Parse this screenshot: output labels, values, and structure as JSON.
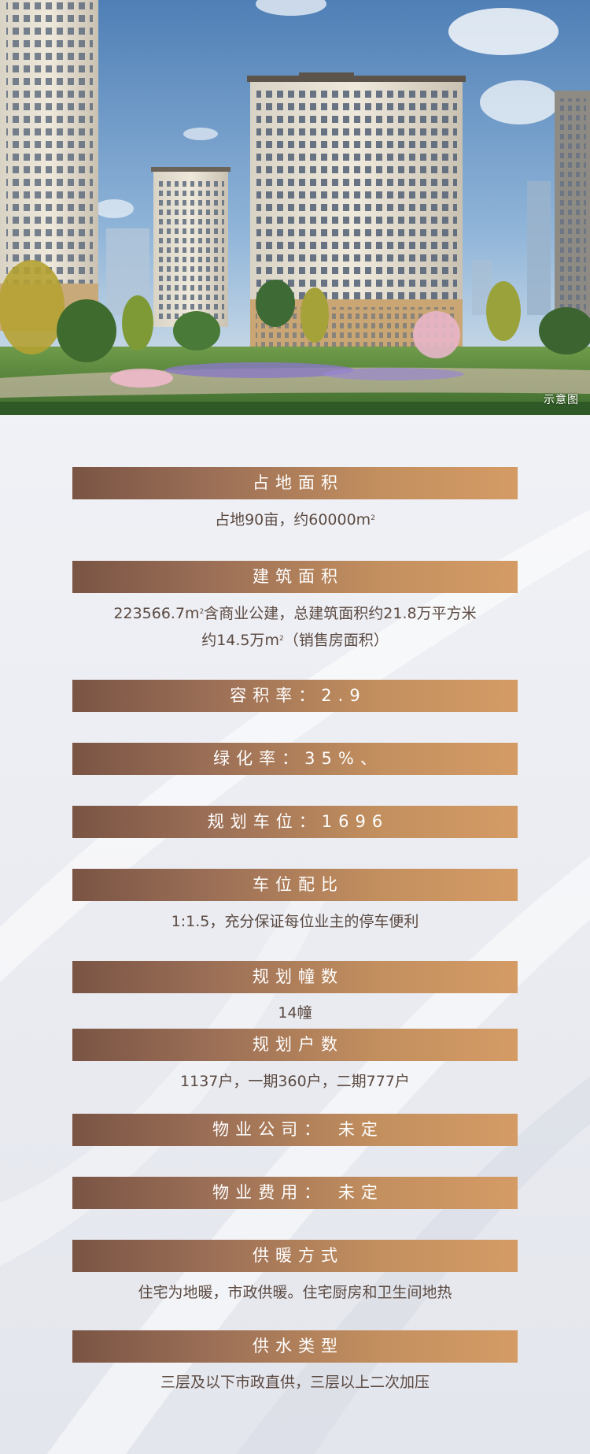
{
  "hero": {
    "caption": "示意图"
  },
  "sections": [
    {
      "title": "占地面积",
      "lines": [
        {
          "text": "占地90亩，约60000m",
          "sup": "2",
          "after": ""
        }
      ]
    },
    {
      "title": "建筑面积",
      "lines": [
        {
          "text": "223566.7m",
          "sup": "2",
          "after": "含商业公建，总建筑面积约21.8万平方米"
        },
        {
          "text": "约14.5万m",
          "sup": "2",
          "after": "（销售房面积）"
        }
      ]
    },
    {
      "title": "容积率：2.9",
      "lines": []
    },
    {
      "title": "绿化率：35%、",
      "lines": []
    },
    {
      "title": "规划车位：1696",
      "lines": []
    },
    {
      "title": "车位配比",
      "lines": [
        {
          "text": "1:1.5，充分保证每位业主的停车便利"
        }
      ]
    },
    {
      "title": "规划幢数",
      "lines": [
        {
          "text": "14幢"
        }
      ]
    },
    {
      "title": "规划户数",
      "lines": [
        {
          "text": "1137户，一期360户，二期777户"
        }
      ]
    },
    {
      "title": "物业公司： 未定",
      "lines": []
    },
    {
      "title": "物业费用： 未定",
      "lines": []
    },
    {
      "title": "供暖方式",
      "lines": [
        {
          "text": "住宅为地暖，市政供暖。住宅厨房和卫生间地热"
        }
      ]
    },
    {
      "title": "供水类型",
      "lines": [
        {
          "text": "三层及以下市政直供，三层以上二次加压"
        }
      ]
    }
  ],
  "colors": {
    "band_start": "#7a5444",
    "band_end": "#d49b65",
    "text": "#5b4a42"
  }
}
